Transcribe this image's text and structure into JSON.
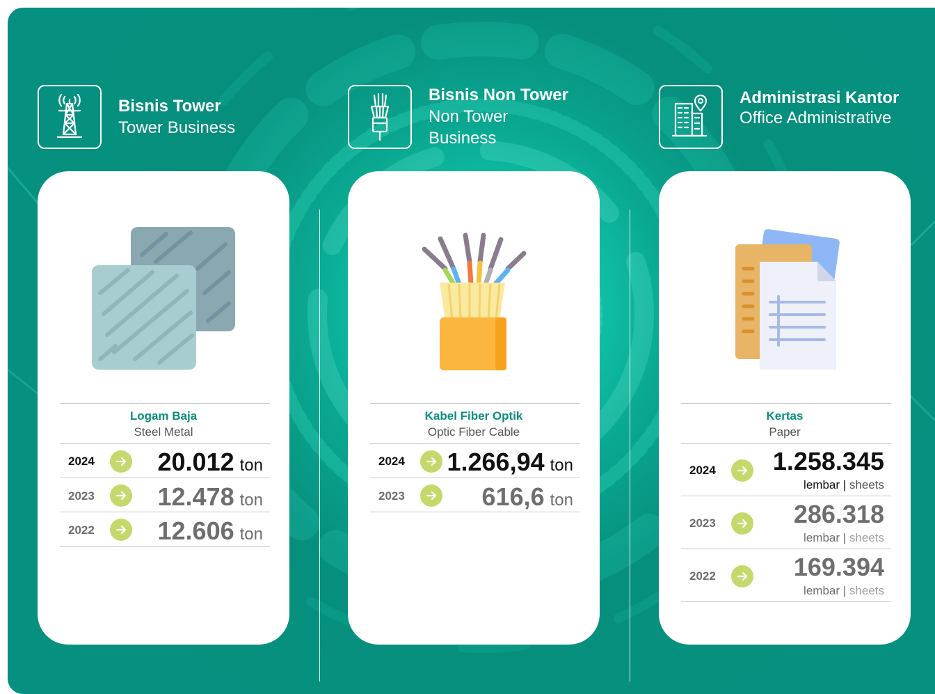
{
  "colors": {
    "teal": "#06907f",
    "accent_green": "#c4d96b",
    "title_green": "#0a8f79",
    "current_year": "#111111",
    "past_year": "#6e6e6e"
  },
  "sections": [
    {
      "icon": "transmission-tower-icon",
      "title": "Bisnis Tower",
      "subtitle": "Tower Business",
      "card": {
        "illustration": "steel-metal-sheets-icon",
        "item_title": "Logam Baja",
        "item_subtitle": "Steel Metal",
        "rows": [
          {
            "year": "2024",
            "value": "20.012",
            "unit": "ton"
          },
          {
            "year": "2023",
            "value": "12.478",
            "unit": "ton"
          },
          {
            "year": "2022",
            "value": "12.606",
            "unit": "ton"
          }
        ]
      }
    },
    {
      "icon": "fiber-cable-icon",
      "title": "Bisnis Non Tower",
      "subtitle": "Non Tower Business",
      "card": {
        "illustration": "fiber-optic-cable-icon",
        "item_title": "Kabel Fiber Optik",
        "item_subtitle": "Optic Fiber Cable",
        "rows": [
          {
            "year": "2024",
            "value": "1.266,94",
            "unit": "ton"
          },
          {
            "year": "2023",
            "value": "616,6",
            "unit": "ton"
          }
        ]
      }
    },
    {
      "icon": "office-building-location-icon",
      "title": "Administrasi Kantor",
      "subtitle": "Office Administrative",
      "card": {
        "illustration": "paper-documents-icon",
        "item_title": "Kertas",
        "item_subtitle": "Paper",
        "unit_id": "lembar",
        "unit_separator": "|",
        "unit_en": "sheets",
        "rows": [
          {
            "year": "2024",
            "value": "1.258.345"
          },
          {
            "year": "2023",
            "value": "286.318"
          },
          {
            "year": "2022",
            "value": "169.394"
          }
        ]
      }
    }
  ]
}
